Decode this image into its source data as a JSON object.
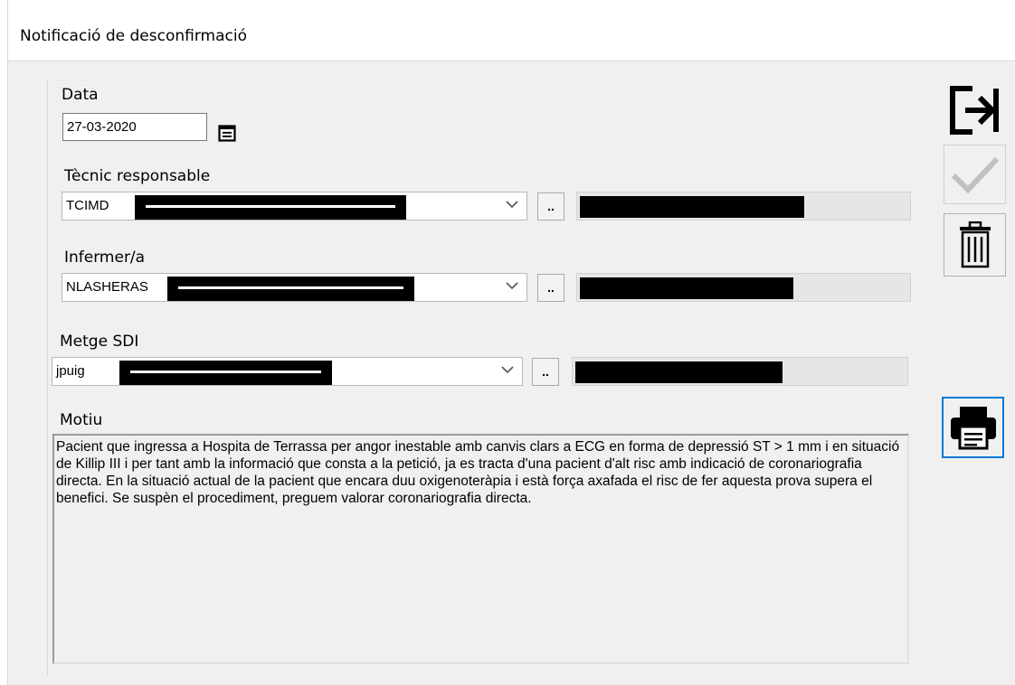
{
  "window": {
    "title": "Notificació de desconfirmació"
  },
  "form": {
    "data_label": "Data",
    "data_value": "27-03-2020",
    "tecnic_label": "Tècnic responsable",
    "tecnic_code": "TCIMD",
    "infermer_label": "Infermer/a",
    "infermer_code": "NLASHERAS",
    "metge_label": "Metge SDI",
    "metge_code": "jpuig",
    "lookup_label": "..",
    "motiu_label": "Motiu",
    "motiu_text": "Pacient que ingressa a Hospita de Terrassa per angor inestable amb canvis clars a ECG en forma de depressió ST > 1 mm i en situació de Killip III i per tant amb la informació que consta a la petició, ja es tracta d'una pacient d'alt risc amb indicació de coronariografia directa. En la situació actual de la pacient que encara duu oxigenoteràpia i està força axafada el risc de fer aquesta prova supera el benefici. Se suspèn el procediment, preguem valorar coronariografia directa."
  },
  "toolbar": {
    "exit_icon": "exit-icon",
    "confirm_icon": "check-icon",
    "delete_icon": "trash-icon",
    "print_icon": "printer-icon"
  },
  "colors": {
    "focus_border": "#0078d7",
    "disabled_icon": "#c0c0c0"
  }
}
